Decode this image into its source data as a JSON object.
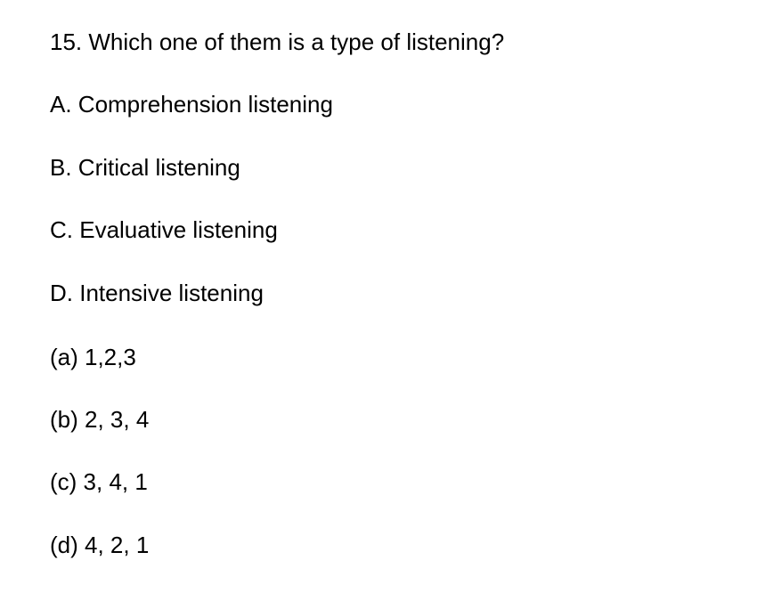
{
  "question": {
    "text": "15. Which one of them is a type of listening?"
  },
  "options": [
    {
      "label": "A. Comprehension listening"
    },
    {
      "label": "B. Critical listening"
    },
    {
      "label": "C. Evaluative listening"
    },
    {
      "label": "D. Intensive listening"
    }
  ],
  "answers": [
    {
      "label": "(a) 1,2,3"
    },
    {
      "label": "(b) 2, 3, 4"
    },
    {
      "label": "(c) 3, 4, 1"
    },
    {
      "label": "(d) 4, 2, 1"
    }
  ]
}
